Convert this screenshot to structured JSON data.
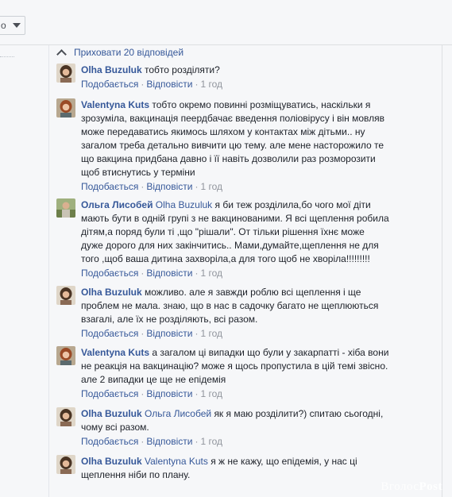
{
  "topbar": {
    "dropdown_value": "о"
  },
  "thread": {
    "hide_replies_label": "Приховати 20 відповідей"
  },
  "actions": {
    "like": "Подобається",
    "reply": "Відповісти",
    "separator": "·"
  },
  "comments": [
    {
      "author": "Olha Buzuluk",
      "tag": "",
      "lines": [
        "тобто розділяти?"
      ],
      "time": "1 год",
      "avatar": "woman-dark-hair"
    },
    {
      "author": "Valentyna Kuts",
      "tag": "",
      "lines": [
        "тобто окремо повинні розміщуватись, наскільки я",
        "зрозуміла, вакцинація пеердбачає введення поліовірусу і він мовляв",
        "може передаватись якимось шляхом у контактах між дітьми.. ну",
        "загалом треба детально вивчити цю тему. але мене насторожило те",
        "що вакцина придбана давно і її навіть дозволили раз розморозити",
        "щоб втиснутись у терміни"
      ],
      "time": "1 год",
      "avatar": "woman-red-hair"
    },
    {
      "author": "Ольга Лисобей",
      "tag": "Olha Buzuluk",
      "lines": [
        "я би теж розділила,бо чого мої діти",
        "мають бути в одній групі з не вакцинованими. Я всі щеплення робила",
        "дітям,а поряд були ті ,що \"рішали\". От тільки рішення їхнє може",
        "дуже дорого для них закінчитись.. Мами,думайте,щеплення не для",
        "того ,щоб ваша дитина захворіла,а для того щоб не хворіла!!!!!!!!!"
      ],
      "time": "1 год",
      "avatar": "man-outdoor"
    },
    {
      "author": "Olha Buzuluk",
      "tag": "",
      "lines": [
        "можливо. але я завжди роблю всі щеплення і ще",
        "проблем не мала. знаю, що в нас в садочку багато не щеплюються",
        "взагалі, але їх не розділяють, всі разом."
      ],
      "time": "1 год",
      "avatar": "woman-dark-hair"
    },
    {
      "author": "Valentyna Kuts",
      "tag": "",
      "lines": [
        "а загалом ці випадки що були у закарпатті - хіба вони",
        "не реакція на вакцинацію? може я щось пропустила в цій темі звісно.",
        "але 2 випадки це ще не епідемія"
      ],
      "time": "1 год",
      "avatar": "woman-red-hair"
    },
    {
      "author": "Olha Buzuluk",
      "tag": "Ольга Лисобей",
      "lines": [
        "як я маю розділити?) спитаю сьогодні,",
        "чому всі разом."
      ],
      "time": "1 год",
      "avatar": "woman-dark-hair"
    },
    {
      "author": "Olha Buzuluk",
      "tag": "Valentyna Kuts",
      "lines": [
        "я ж не кажу, що епідемія, у нас ці",
        "щеплення ніби по плану."
      ],
      "time": "",
      "avatar": "woman-dark-hair"
    }
  ],
  "watermark": {
    "text1": "Вголос",
    "text2": "Post"
  }
}
